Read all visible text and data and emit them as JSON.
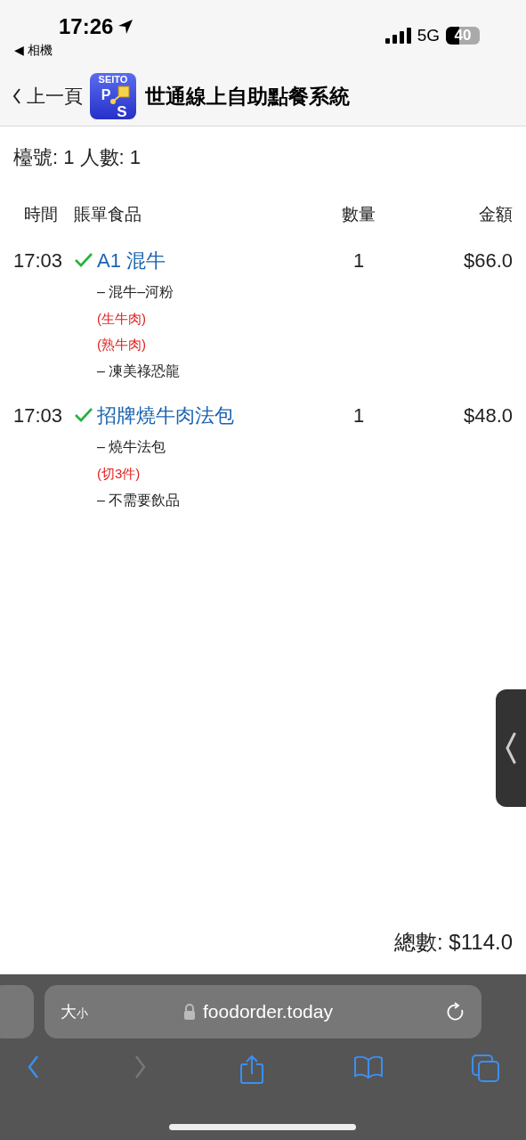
{
  "status_bar": {
    "time": "17:26",
    "back_app": "◀ 相機",
    "network": "5G",
    "battery": "40"
  },
  "header": {
    "back": "上一頁",
    "logo": {
      "top": "SEITO",
      "left": "P",
      "right": "S"
    },
    "title": "世通線上自助點餐系統"
  },
  "table_info": "檯號: 1 人數: 1",
  "columns": [
    "時間",
    "賬單食品",
    "數量",
    "金額"
  ],
  "items": [
    {
      "time": "17:03",
      "checked": true,
      "name": "A1 混牛",
      "qty": "1",
      "amount": "$66.0",
      "options": [
        {
          "kind": "choice",
          "text": "– 混牛–河粉"
        },
        {
          "kind": "note",
          "text": "(生牛肉)"
        },
        {
          "kind": "note",
          "text": "(熟牛肉)"
        },
        {
          "kind": "choice",
          "text": "– 凍美祿恐龍"
        }
      ]
    },
    {
      "time": "17:03",
      "checked": true,
      "name": "招牌燒牛肉法包",
      "qty": "1",
      "amount": "$48.0",
      "options": [
        {
          "kind": "choice",
          "text": "– 燒牛法包"
        },
        {
          "kind": "note",
          "text": "(切3件)"
        },
        {
          "kind": "choice",
          "text": "– 不需要飲品"
        }
      ]
    }
  ],
  "total": "總數: $114.0",
  "browser": {
    "text_size_large": "大",
    "text_size_small": "小",
    "url": "foodorder.today"
  }
}
